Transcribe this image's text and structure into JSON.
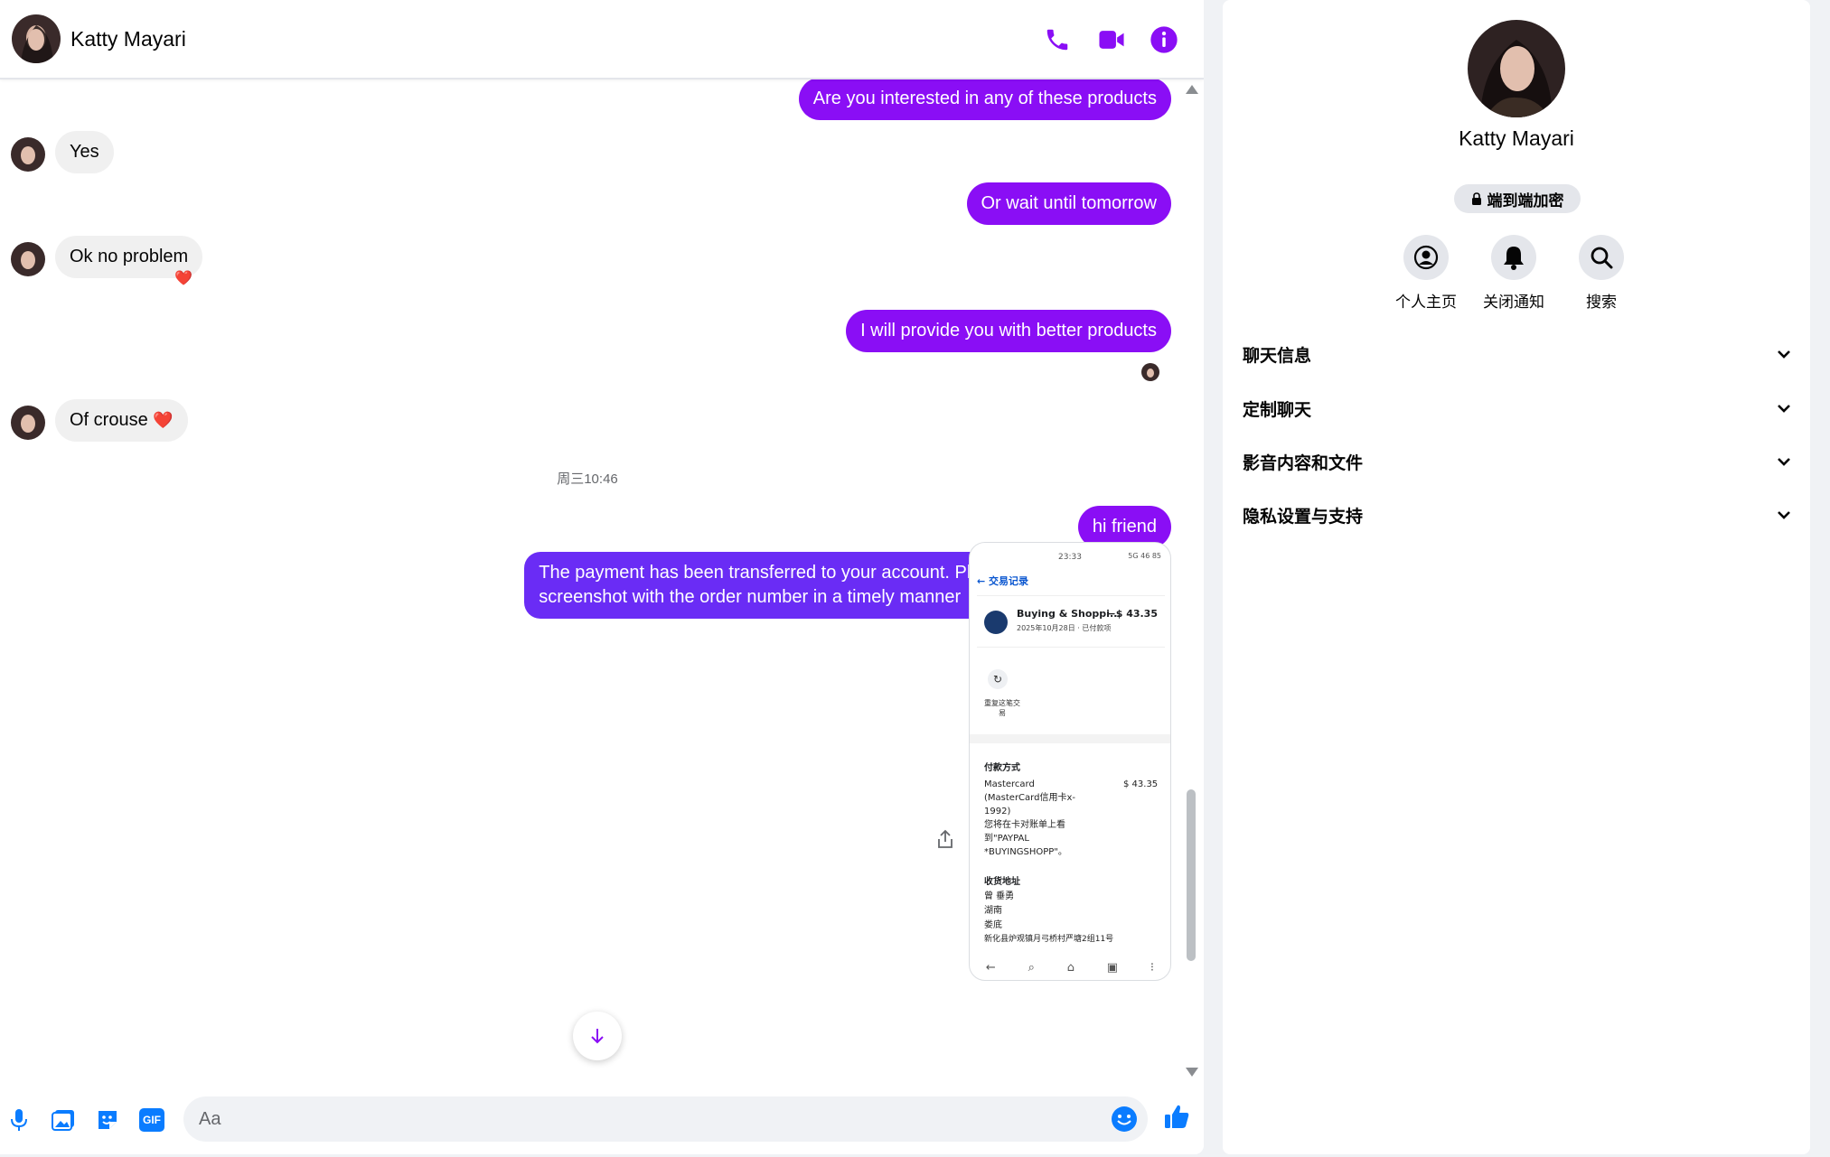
{
  "contact": {
    "name": "Katty Mayari"
  },
  "header": {
    "call_icon": "phone-icon",
    "video_icon": "video-camera-icon",
    "info_icon": "info-icon"
  },
  "messages": {
    "m1": "Are you interested in any of these products",
    "m2": "Yes",
    "m3": "Or wait until tomorrow",
    "m4": "Ok no problem",
    "m4_reaction": "❤️",
    "m5": "I will provide you with better products",
    "m6": "Of crouse",
    "m6_emoji": "❤️",
    "timestamp": "周三10:46",
    "m7": "hi friend",
    "m8_line1": "The payment has been transferred to your account. Please provide me with a",
    "m8_line2": "screenshot with the order number in a timely manner"
  },
  "attachment": {
    "time": "23:33",
    "status": "5G 46 85",
    "back_label": "← 交易记录",
    "merchant": "Buying & Shoppi...",
    "amount": "−$ 43.35",
    "date": "2025年10月28日 · 已付款项",
    "repeat_label": "重复这笔交易",
    "payment_heading": "付款方式",
    "card_line1": "Mastercard",
    "card_line2": "(MasterCard信用卡x-",
    "card_line3": "1992)",
    "card_line4": "您将在卡对账单上看",
    "card_line5": "到\"PAYPAL",
    "card_line6": "*BUYINGSHOPP\"。",
    "card_amount": "$ 43.35",
    "address_heading": "收货地址",
    "addr_line1": "曾 垂勇",
    "addr_line2": "湖南",
    "addr_line3": "娄底",
    "addr_line4": "新化县炉观镇月弓桥村严塘2组11号"
  },
  "composer": {
    "placeholder": "Aa",
    "mic_icon": "microphone-icon",
    "photo_icon": "photo-gallery-icon",
    "sticker_icon": "sticker-icon",
    "gif_label": "GIF",
    "emoji_icon": "emoji-icon",
    "like_icon": "thumbs-up-icon"
  },
  "panel": {
    "name": "Katty Mayari",
    "e2e_label": "端到端加密",
    "actions": {
      "profile": "个人主页",
      "mute": "关闭通知",
      "search": "搜索"
    },
    "sections": {
      "chat_info": "聊天信息",
      "customize": "定制聊天",
      "media": "影音内容和文件",
      "privacy": "隐私设置与支持"
    }
  },
  "colors": {
    "outgoing_bubble": "#8a0ef5",
    "outgoing_bubble_last": "#6a2cf5",
    "header_accent": "#8a0ef5",
    "composer_accent": "#0a7cff",
    "incoming_bubble": "#f0f0f0"
  }
}
